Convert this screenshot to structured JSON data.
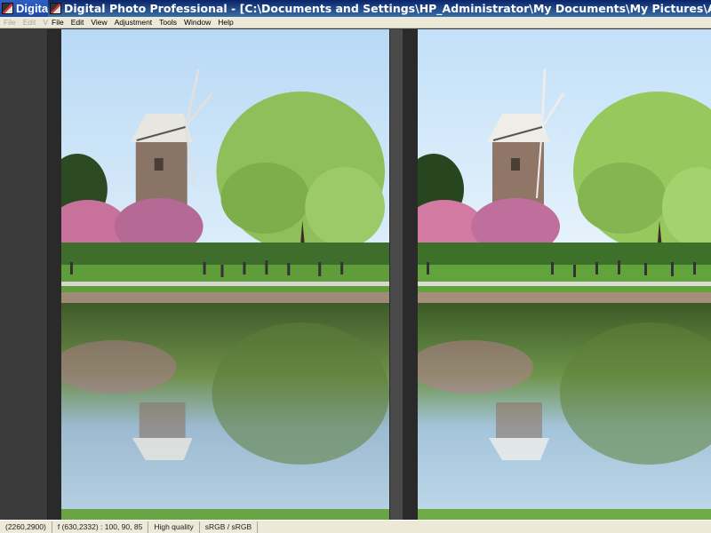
{
  "back_window": {
    "title": "Digital",
    "menus": [
      "File",
      "Edit",
      "V"
    ]
  },
  "front_window": {
    "title": "Digital Photo Professional - [C:\\Documents and Settings\\HP_Administrator\\My Documents\\My Pictures\\Adobe\\Digital Camera Pho...",
    "menus": [
      "File",
      "Edit",
      "View",
      "Adjustment",
      "Tools",
      "Window",
      "Help"
    ]
  },
  "status": {
    "image_size": "(2260,2900)",
    "cursor_info": "f (630,2332) : 100, 90, 85",
    "quality": "High quality",
    "color_space": "sRGB / sRGB"
  },
  "colors": {
    "sky": "#c9e4f7",
    "water": "#8fb7d6",
    "grass": "#5f9c3a",
    "blossom": "#c8719a",
    "tree": "#8fbf5a"
  }
}
